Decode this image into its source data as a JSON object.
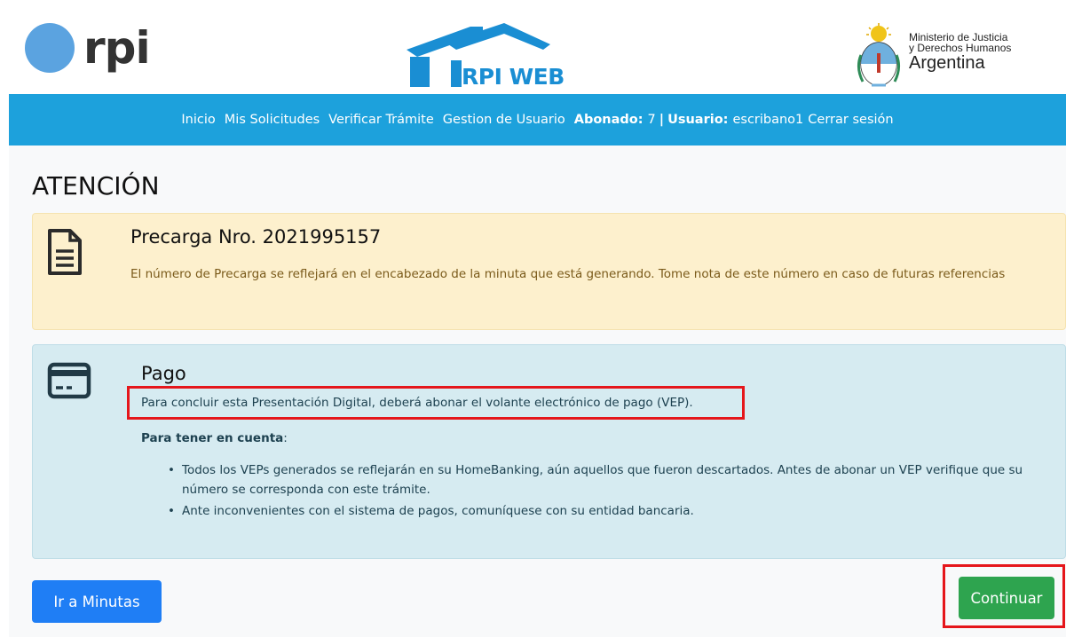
{
  "header": {
    "rpi_logo_text": "rpi",
    "rpi_web_logo_text": "RPI WEB",
    "ministerio": {
      "line1": "Ministerio de Justicia",
      "line2": "y Derechos Humanos",
      "line3": "Argentina"
    }
  },
  "nav": {
    "inicio": "Inicio",
    "mis_solicitudes": "Mis Solicitudes",
    "verificar_tramite": "Verificar Trámite",
    "gestion_usuario": "Gestion de Usuario",
    "abonado_label": "Abonado:",
    "abonado_value": "7",
    "separator": "|",
    "usuario_label": "Usuario:",
    "usuario_value": "escribano1",
    "cerrar_sesion": "Cerrar sesión"
  },
  "page": {
    "title": "ATENCIÓN"
  },
  "precarga": {
    "icon": "document-icon",
    "heading": "Precarga Nro. 2021995157",
    "body": "El número de Precarga se reflejará en el encabezado de la minuta que está generando. Tome nota de este número en caso de futuras referencias"
  },
  "pago": {
    "icon": "credit-card-icon",
    "heading": "Pago",
    "sentence": "Para concluir esta Presentación Digital, deberá abonar el volante electrónico de pago (VEP).",
    "tener_label": "Para tener en cuenta",
    "tener_colon": ":",
    "items": [
      "Todos los VEPs generados se reflejarán en su HomeBanking, aún aquellos que fueron descartados. Antes de abonar un VEP verifique que su número se corresponda con este trámite.",
      "Ante inconvenientes con el sistema de pagos, comuníquese con su entidad bancaria."
    ]
  },
  "buttons": {
    "ir_a_minutas": "Ir a Minutas",
    "continuar": "Continuar"
  },
  "colors": {
    "navbar": "#1da1dc",
    "warning_bg": "#fdf0cd",
    "info_bg": "#d6ebf1",
    "primary": "#1f7ef5",
    "success": "#2ea44f",
    "highlight": "#e5161b"
  }
}
